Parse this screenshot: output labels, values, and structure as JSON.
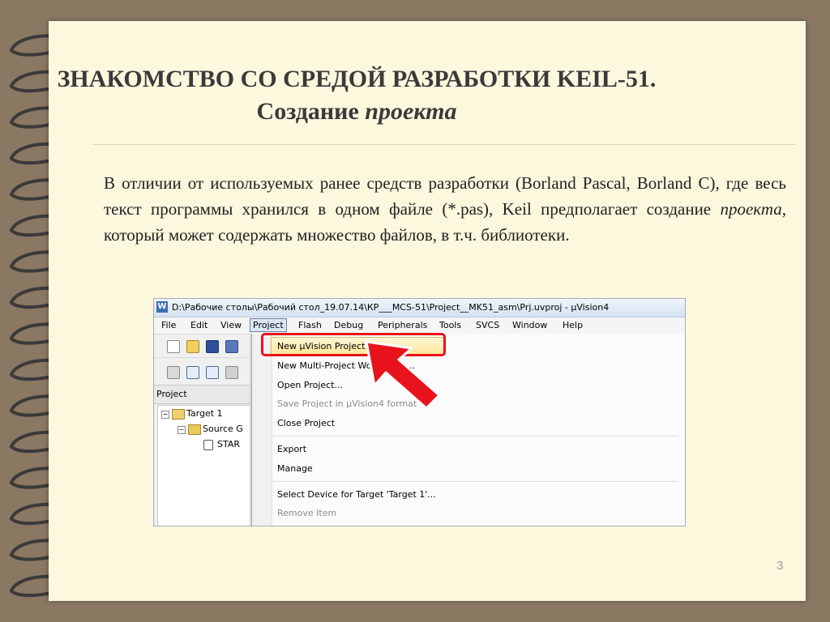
{
  "slide": {
    "title_line1": "ЗНАКОМСТВО СО СРЕДОЙ РАЗРАБОТКИ KEIL-51.",
    "title_line2_normal": "Создание ",
    "title_line2_italic": "проекта",
    "paragraph_part1": "В отличии от используемых ранее средств разработки (Borland Pascal, Borland C), где весь текст программы хранился в одном файле (*.pas), Keil предполагает создание ",
    "paragraph_italic": "проекта,",
    "paragraph_part2": " который может содержать множество файлов, в т.ч. библиотеки.",
    "page_number": "3"
  },
  "screenshot": {
    "window_title": "D:\\Рабочие столы\\Рабочий стол_19.07.14\\КР___MCS-51\\Project__MK51_asm\\Prj.uvproj - µVision4",
    "app_icon_glyph": "W",
    "menu": [
      "File",
      "Edit",
      "View",
      "Project",
      "Flash",
      "Debug",
      "Peripherals",
      "Tools",
      "SVCS",
      "Window",
      "Help"
    ],
    "active_menu": "Project",
    "project_panel_label": "Project",
    "tree": {
      "target": "Target 1",
      "group": "Source G",
      "file": "STAR",
      "expand_glyph": "−"
    },
    "dropdown": {
      "new_project": "New µVision Project...",
      "new_multi_project": "New Multi-Project Workspace...",
      "open_project": "Open Project...",
      "save_project": "Save Project in µVision4 format",
      "close_project": "Close Project",
      "export": "Export",
      "manage": "Manage",
      "select_device": "Select Device for Target 'Target 1'...",
      "remove_item": "Remove Item"
    }
  },
  "colors": {
    "background": "#8b7862",
    "page": "#fbf8dd",
    "callout": "#e8131c",
    "highlight": "#ffe79a"
  }
}
